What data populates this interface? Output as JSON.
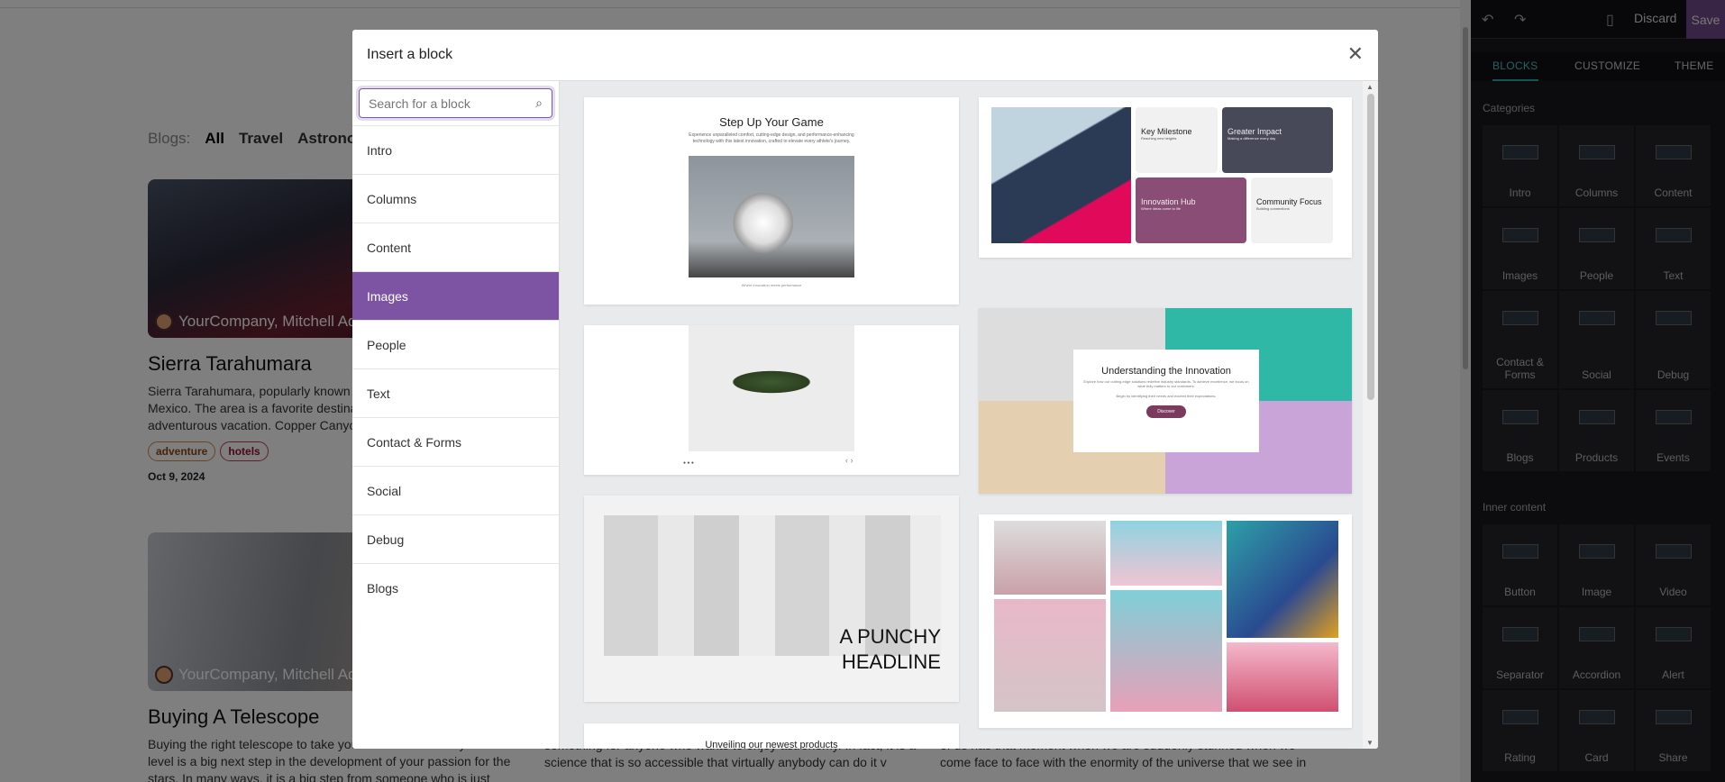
{
  "page": {
    "blogs_label": "Blogs:",
    "filters": [
      "All",
      "Travel",
      "Astronomy"
    ],
    "posts": [
      {
        "author": "YourCompany, Mitchell Admin",
        "title": "Sierra Tarahumara",
        "excerpt": "Sierra Tarahumara, popularly known as Copper Canyon is situated in Mexico. The area is a favorite destination among those looking for an adventurous vacation. Copper Canyon is one of the six gorges in the...",
        "tags": [
          "adventure",
          "hotels"
        ],
        "date": "Oct 9, 2024"
      },
      {
        "author": "YourCompany, Mitchell Admin",
        "title": "Buying A Telescope",
        "excerpt": "Buying the right telescope to take your love of astronomy to the next level is a big next step in the development of your passion for the stars. In many ways, it is a big step from someone who is just"
      }
    ],
    "col2_text": "something for anyone who wants to enjoy astronomy. In fact, it is a science that is so accessible that virtually anybody can do it v",
    "col3_text": "of us has that moment when we are suddenly stunned when we come face to face with the enormity of the universe that we see in"
  },
  "panel": {
    "discard": "Discard",
    "save": "Save",
    "tabs": [
      "BLOCKS",
      "CUSTOMIZE",
      "THEME"
    ],
    "categories_label": "Categories",
    "categories": [
      "Intro",
      "Columns",
      "Content",
      "Images",
      "People",
      "Text",
      "Contact & Forms",
      "Social",
      "Debug",
      "Blogs",
      "Products",
      "Events"
    ],
    "inner_label": "Inner content",
    "inner": [
      "Button",
      "Image",
      "Video",
      "Separator",
      "Accordion",
      "Alert",
      "Rating",
      "Card",
      "Share"
    ]
  },
  "modal": {
    "title": "Insert a block",
    "search_placeholder": "Search for a block",
    "categories": [
      "Intro",
      "Columns",
      "Content",
      "Images",
      "People",
      "Text",
      "Contact & Forms",
      "Social",
      "Debug",
      "Blogs"
    ],
    "active_category": "Images",
    "snippets": {
      "s1": {
        "title": "Step Up Your Game",
        "text": "Experience unparalleled comfort, cutting-edge design, and performance-enhancing technology with this latest innovation, crafted to elevate every athlete's journey.",
        "caption": "Where innovation meets performance"
      },
      "s2": {
        "items": [
          {
            "title": "Key Milestone",
            "sub": "Reaching new heights"
          },
          {
            "title": "Greater Impact",
            "sub": "Making a difference every day"
          },
          {
            "title": "Innovation Hub",
            "sub": "Where ideas come to life"
          },
          {
            "title": "Community Focus",
            "sub": "Building connections"
          }
        ]
      },
      "s4": {
        "title": "Understanding the Innovation",
        "text1": "Explore how our cutting-edge solutions redefine industry standards. To achieve excellence, we focus on what truly matters to our customers.",
        "text2": "Begin by identifying their needs and exceed their expectations.",
        "button": "Discover"
      },
      "s5": {
        "headline": "A PUNCHY HEADLINE"
      },
      "s7": {
        "title": "Unveiling our newest products"
      }
    }
  },
  "colors": {
    "accent": "#7d54a3",
    "panel_bg": "#18171d",
    "teal": "#2aa"
  }
}
